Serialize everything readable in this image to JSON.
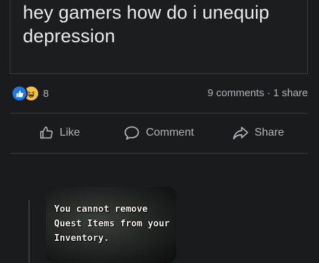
{
  "post": {
    "text": "hey gamers how do i unequip depression"
  },
  "reactions": {
    "count": "8",
    "types": [
      "like-icon",
      "haha-icon"
    ],
    "like_color": "#1877f2",
    "haha_color": "#f7c23b"
  },
  "meta": {
    "comments": "9 comments",
    "separator": "·",
    "shares": "1 share"
  },
  "actions": {
    "like_label": "Like",
    "comment_label": "Comment",
    "share_label": "Share"
  },
  "comment": {
    "image_lines": [
      "You cannot remove",
      "Quest Items from your",
      "Inventory."
    ]
  },
  "colors": {
    "background": "#1a1b1d",
    "text_primary": "#e4e6eb",
    "text_secondary": "#b0b3b8",
    "divider": "#35363a"
  }
}
